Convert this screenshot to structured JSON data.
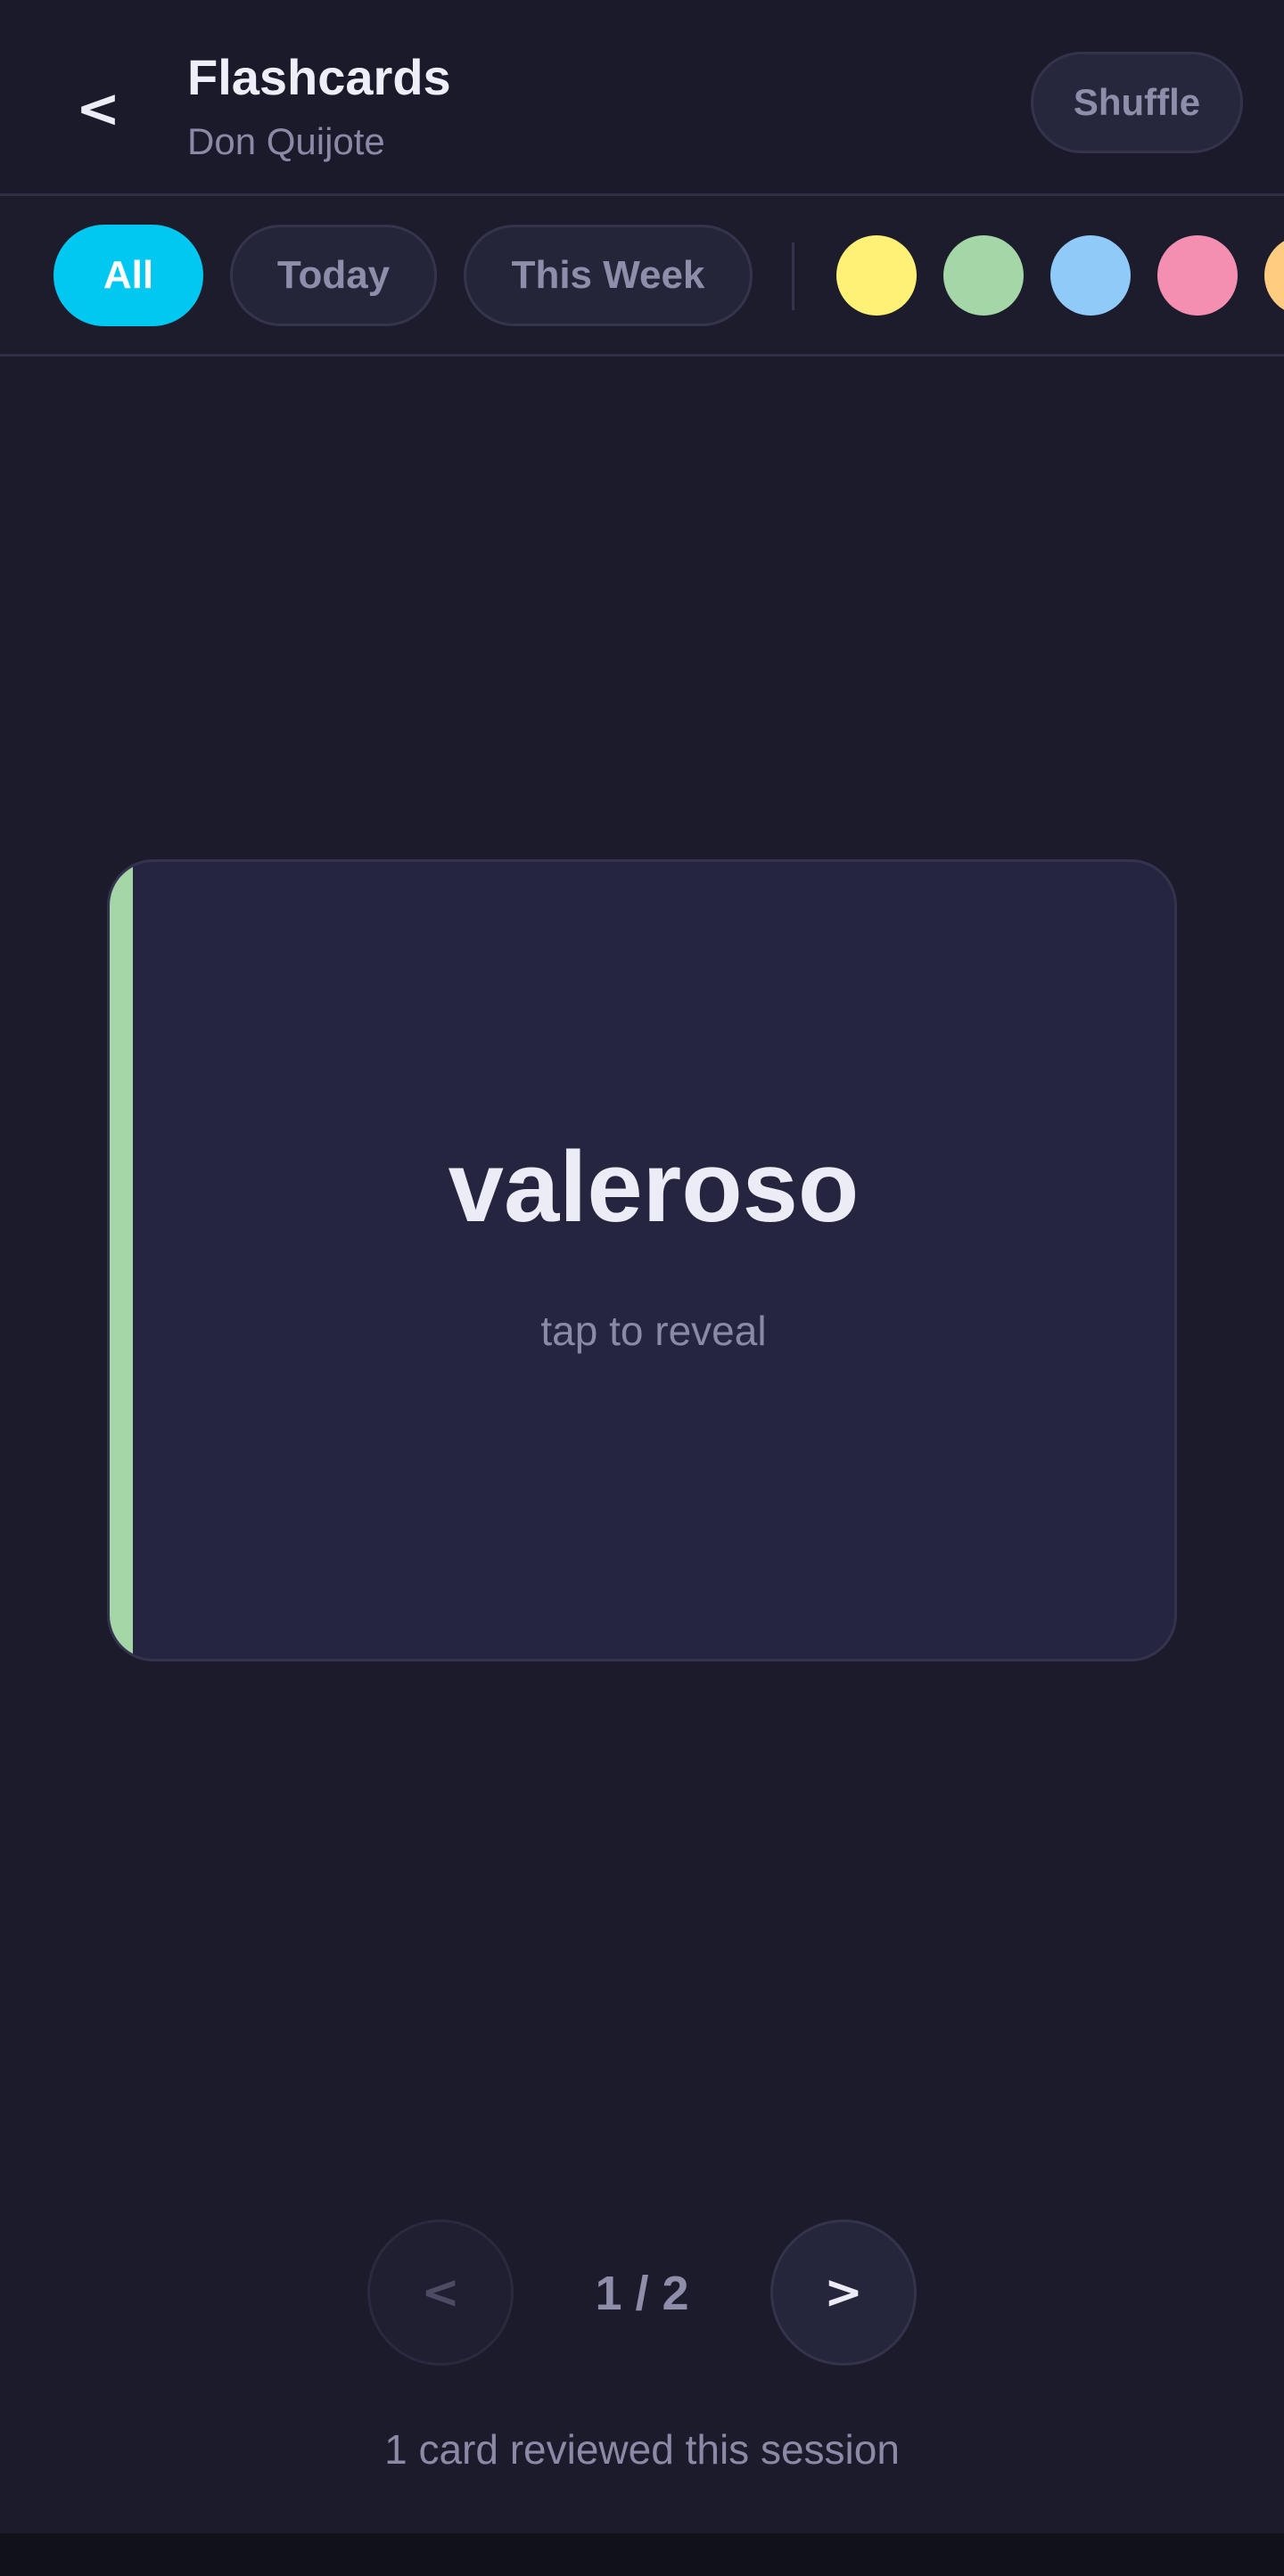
{
  "header": {
    "back_label": "<",
    "title": "Flashcards",
    "subtitle": "Don Quijote",
    "shuffle_label": "Shuffle"
  },
  "filters": {
    "all_label": "All",
    "today_label": "Today",
    "week_label": "This Week",
    "active": "All"
  },
  "colors": {
    "accent": "#00c8f0",
    "swatches": [
      "#fff176",
      "#a5d6a7",
      "#90caf9",
      "#f48fb1",
      "#ffcc80"
    ]
  },
  "card": {
    "word": "valeroso",
    "hint": "tap to reveal",
    "accent_color": "#a5d6a7"
  },
  "navigation": {
    "prev_label": "<",
    "next_label": ">",
    "counter": "1 / 2"
  },
  "session": {
    "text": "1 card reviewed this session"
  }
}
